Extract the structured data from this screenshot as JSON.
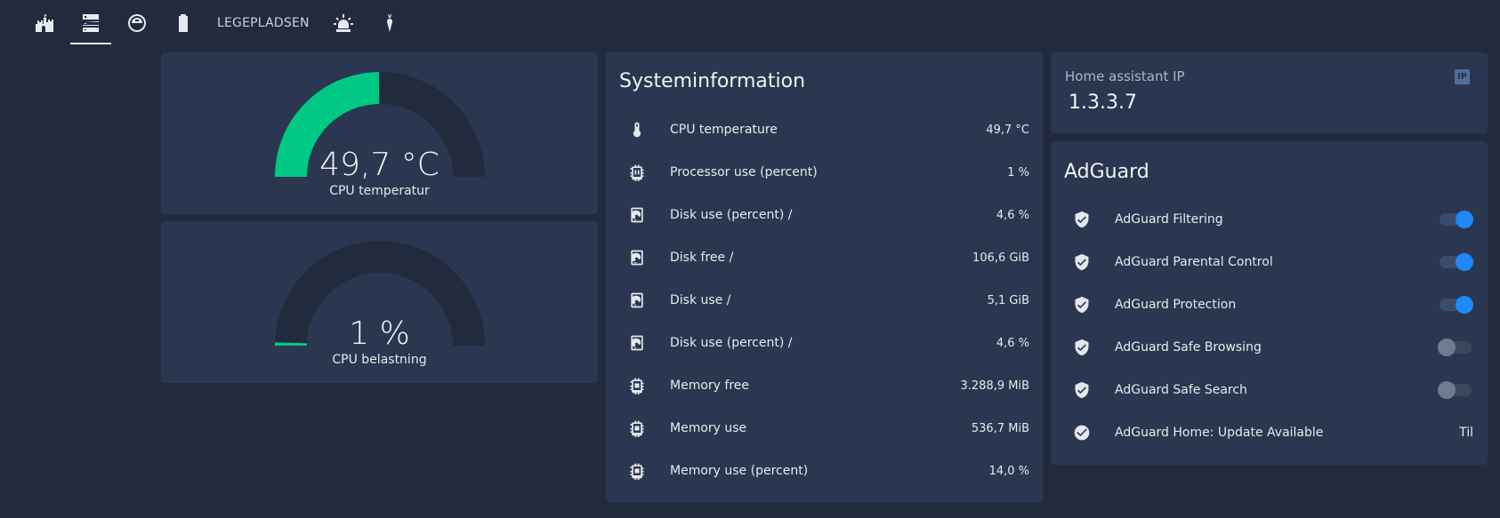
{
  "nav": {
    "tabs": [
      {
        "icon": "castle-icon",
        "active": false
      },
      {
        "icon": "server-icon",
        "active": true
      },
      {
        "icon": "robot-vacuum-icon",
        "active": false
      },
      {
        "icon": "battery-icon",
        "active": false
      },
      {
        "label": "LEGEPLADSEN",
        "active": false
      },
      {
        "icon": "alarm-light-icon",
        "active": false
      },
      {
        "icon": "carrot-icon",
        "active": false
      }
    ]
  },
  "gauges": [
    {
      "value": "49,7 °C",
      "label": "CPU temperatur",
      "level": 0.497,
      "color": "#00c985"
    },
    {
      "value": "1 %",
      "label": "CPU belastning",
      "level": 0.01,
      "color": "#00c985"
    }
  ],
  "system": {
    "title": "Systeminformation",
    "rows": [
      {
        "icon": "thermometer-icon",
        "label": "CPU temperature",
        "value": "49,7 °C"
      },
      {
        "icon": "cpu-64-icon",
        "label": "Processor use (percent)",
        "value": "1 %"
      },
      {
        "icon": "harddisk-icon",
        "label": "Disk use (percent) /",
        "value": "4,6 %"
      },
      {
        "icon": "harddisk-icon",
        "label": "Disk free /",
        "value": "106,6 GiB"
      },
      {
        "icon": "harddisk-icon",
        "label": "Disk use /",
        "value": "5,1 GiB"
      },
      {
        "icon": "harddisk-icon",
        "label": "Disk use (percent) /",
        "value": "4,6 %"
      },
      {
        "icon": "memory-icon",
        "label": "Memory free",
        "value": "3.288,9 MiB"
      },
      {
        "icon": "memory-icon",
        "label": "Memory use",
        "value": "536,7 MiB"
      },
      {
        "icon": "memory-icon",
        "label": "Memory use (percent)",
        "value": "14,0 %"
      }
    ]
  },
  "ip_card": {
    "label": "Home assistant IP",
    "value": "1.3.3.7",
    "badge": "IP"
  },
  "adguard": {
    "title": "AdGuard",
    "rows": [
      {
        "icon": "shield-check-icon",
        "label": "AdGuard Filtering",
        "state": "on"
      },
      {
        "icon": "shield-check-icon",
        "label": "AdGuard Parental Control",
        "state": "on"
      },
      {
        "icon": "shield-check-icon",
        "label": "AdGuard Protection",
        "state": "on"
      },
      {
        "icon": "shield-check-icon",
        "label": "AdGuard Safe Browsing",
        "state": "off"
      },
      {
        "icon": "shield-check-icon",
        "label": "AdGuard Safe Search",
        "state": "off"
      },
      {
        "icon": "check-circle-icon",
        "label": "AdGuard Home: Update Available",
        "value": "Til"
      }
    ]
  },
  "colors": {
    "background": "#222b3e",
    "card": "#2b3750",
    "gauge_track": "#222b3e",
    "gauge_fill": "#00c985",
    "toggle_on": "#1e88f5"
  }
}
